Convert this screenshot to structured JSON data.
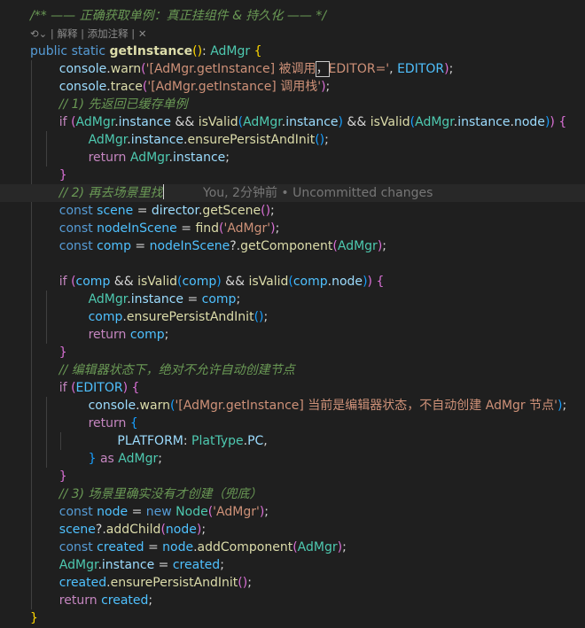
{
  "app": "code-editor",
  "code_lens": {
    "icon": "references-icon",
    "explain": "解释",
    "add_comment": "添加注释",
    "close_icon": "close-icon"
  },
  "blame": "You, 2分钟前 • Uncommitted changes",
  "colors": {
    "background": "#1f1f1f",
    "comment": "#6a9955",
    "keyword": "#569cd6",
    "control": "#c586c0",
    "function": "#dcdcaa",
    "type": "#4ec9b0",
    "string": "#ce9178",
    "variable": "#9cdcfe",
    "constant": "#4fc1ff",
    "bracket_1": "#ffd700",
    "bracket_2": "#da70d6",
    "bracket_3": "#179fff"
  },
  "lines": [
    {
      "indent": 2,
      "tokens": [
        [
          "cm",
          "/** —— 正确获取单例：真正挂组件 & 持久化 —— */"
        ]
      ]
    },
    {
      "lens": true
    },
    {
      "indent": 2,
      "tokens": [
        [
          "kw",
          "public"
        ],
        [
          "pn",
          " "
        ],
        [
          "kw",
          "static"
        ],
        [
          "pn",
          " "
        ],
        [
          "fb",
          "getInstance"
        ],
        [
          "b1",
          "()"
        ],
        [
          "pn",
          ": "
        ],
        [
          "ty",
          "AdMgr"
        ],
        [
          "pn",
          " "
        ],
        [
          "b1",
          "{"
        ]
      ]
    },
    {
      "indent": 6,
      "tokens": [
        [
          "vr",
          "console"
        ],
        [
          "pn",
          "."
        ],
        [
          "fn",
          "warn"
        ],
        [
          "b2",
          "("
        ],
        [
          "st",
          "'[AdMgr.getInstance] 被调用"
        ],
        [
          "sel",
          "，"
        ],
        [
          "st",
          "EDITOR='"
        ],
        [
          "pn",
          ", "
        ],
        [
          "co",
          "EDITOR"
        ],
        [
          "b2",
          ")"
        ],
        [
          "pn",
          ";"
        ]
      ]
    },
    {
      "indent": 6,
      "tokens": [
        [
          "vr",
          "console"
        ],
        [
          "pn",
          "."
        ],
        [
          "fn",
          "trace"
        ],
        [
          "b2",
          "("
        ],
        [
          "st",
          "'[AdMgr.getInstance] 调用栈'"
        ],
        [
          "b2",
          ")"
        ],
        [
          "pn",
          ";"
        ]
      ]
    },
    {
      "indent": 6,
      "tokens": [
        [
          "cm",
          "// 1) 先返回已缓存单例"
        ]
      ]
    },
    {
      "indent": 6,
      "tokens": [
        [
          "ct",
          "if"
        ],
        [
          "pn",
          " "
        ],
        [
          "b2",
          "("
        ],
        [
          "ty",
          "AdMgr"
        ],
        [
          "pn",
          "."
        ],
        [
          "vr",
          "instance"
        ],
        [
          "pn",
          " && "
        ],
        [
          "fn",
          "isValid"
        ],
        [
          "b3",
          "("
        ],
        [
          "ty",
          "AdMgr"
        ],
        [
          "pn",
          "."
        ],
        [
          "vr",
          "instance"
        ],
        [
          "b3",
          ")"
        ],
        [
          "pn",
          " && "
        ],
        [
          "fn",
          "isValid"
        ],
        [
          "b3",
          "("
        ],
        [
          "ty",
          "AdMgr"
        ],
        [
          "pn",
          "."
        ],
        [
          "vr",
          "instance"
        ],
        [
          "pn",
          "."
        ],
        [
          "vr",
          "node"
        ],
        [
          "b3",
          ")"
        ],
        [
          "b2",
          ")"
        ],
        [
          "pn",
          " "
        ],
        [
          "b2",
          "{"
        ]
      ]
    },
    {
      "indent": 10,
      "tokens": [
        [
          "ty",
          "AdMgr"
        ],
        [
          "pn",
          "."
        ],
        [
          "vr",
          "instance"
        ],
        [
          "pn",
          "."
        ],
        [
          "fn",
          "ensurePersistAndInit"
        ],
        [
          "b3",
          "()"
        ],
        [
          "pn",
          ";"
        ]
      ]
    },
    {
      "indent": 10,
      "tokens": [
        [
          "ct",
          "return"
        ],
        [
          "pn",
          " "
        ],
        [
          "ty",
          "AdMgr"
        ],
        [
          "pn",
          "."
        ],
        [
          "vr",
          "instance"
        ],
        [
          "pn",
          ";"
        ]
      ]
    },
    {
      "indent": 6,
      "tokens": [
        [
          "b2",
          "}"
        ]
      ]
    },
    {
      "indent": 6,
      "current": true,
      "blame": true,
      "tokens": [
        [
          "cm",
          "// 2) 再去场景里找"
        ],
        [
          "cursor",
          ""
        ]
      ]
    },
    {
      "indent": 6,
      "tokens": [
        [
          "kw",
          "const"
        ],
        [
          "pn",
          " "
        ],
        [
          "co",
          "scene"
        ],
        [
          "pn",
          " = "
        ],
        [
          "vr",
          "director"
        ],
        [
          "pn",
          "."
        ],
        [
          "fn",
          "getScene"
        ],
        [
          "b2",
          "()"
        ],
        [
          "pn",
          ";"
        ]
      ]
    },
    {
      "indent": 6,
      "tokens": [
        [
          "kw",
          "const"
        ],
        [
          "pn",
          " "
        ],
        [
          "co",
          "nodeInScene"
        ],
        [
          "pn",
          " = "
        ],
        [
          "fn",
          "find"
        ],
        [
          "b2",
          "("
        ],
        [
          "st",
          "'AdMgr'"
        ],
        [
          "b2",
          ")"
        ],
        [
          "pn",
          ";"
        ]
      ]
    },
    {
      "indent": 6,
      "tokens": [
        [
          "kw",
          "const"
        ],
        [
          "pn",
          " "
        ],
        [
          "co",
          "comp"
        ],
        [
          "pn",
          " = "
        ],
        [
          "co",
          "nodeInScene"
        ],
        [
          "pn",
          "?."
        ],
        [
          "fn",
          "getComponent"
        ],
        [
          "b2",
          "("
        ],
        [
          "ty",
          "AdMgr"
        ],
        [
          "b2",
          ")"
        ],
        [
          "pn",
          ";"
        ]
      ]
    },
    {
      "indent": 0,
      "tokens": []
    },
    {
      "indent": 6,
      "tokens": [
        [
          "ct",
          "if"
        ],
        [
          "pn",
          " "
        ],
        [
          "b2",
          "("
        ],
        [
          "co",
          "comp"
        ],
        [
          "pn",
          " && "
        ],
        [
          "fn",
          "isValid"
        ],
        [
          "b3",
          "("
        ],
        [
          "co",
          "comp"
        ],
        [
          "b3",
          ")"
        ],
        [
          "pn",
          " && "
        ],
        [
          "fn",
          "isValid"
        ],
        [
          "b3",
          "("
        ],
        [
          "co",
          "comp"
        ],
        [
          "pn",
          "."
        ],
        [
          "vr",
          "node"
        ],
        [
          "b3",
          ")"
        ],
        [
          "b2",
          ")"
        ],
        [
          "pn",
          " "
        ],
        [
          "b2",
          "{"
        ]
      ]
    },
    {
      "indent": 10,
      "tokens": [
        [
          "ty",
          "AdMgr"
        ],
        [
          "pn",
          "."
        ],
        [
          "vr",
          "instance"
        ],
        [
          "pn",
          " = "
        ],
        [
          "co",
          "comp"
        ],
        [
          "pn",
          ";"
        ]
      ]
    },
    {
      "indent": 10,
      "tokens": [
        [
          "co",
          "comp"
        ],
        [
          "pn",
          "."
        ],
        [
          "fn",
          "ensurePersistAndInit"
        ],
        [
          "b3",
          "()"
        ],
        [
          "pn",
          ";"
        ]
      ]
    },
    {
      "indent": 10,
      "tokens": [
        [
          "ct",
          "return"
        ],
        [
          "pn",
          " "
        ],
        [
          "co",
          "comp"
        ],
        [
          "pn",
          ";"
        ]
      ]
    },
    {
      "indent": 6,
      "tokens": [
        [
          "b2",
          "}"
        ]
      ]
    },
    {
      "indent": 6,
      "tokens": [
        [
          "cm",
          "// 编辑器状态下，绝对不允许自动创建节点"
        ]
      ]
    },
    {
      "indent": 6,
      "tokens": [
        [
          "ct",
          "if"
        ],
        [
          "pn",
          " "
        ],
        [
          "b2",
          "("
        ],
        [
          "co",
          "EDITOR"
        ],
        [
          "b2",
          ")"
        ],
        [
          "pn",
          " "
        ],
        [
          "b2",
          "{"
        ]
      ]
    },
    {
      "indent": 10,
      "tokens": [
        [
          "vr",
          "console"
        ],
        [
          "pn",
          "."
        ],
        [
          "fn",
          "warn"
        ],
        [
          "b3",
          "("
        ],
        [
          "st",
          "'[AdMgr.getInstance] 当前是编辑器状态，不自动创建 AdMgr 节点'"
        ],
        [
          "b3",
          ")"
        ],
        [
          "pn",
          ";"
        ]
      ]
    },
    {
      "indent": 10,
      "tokens": [
        [
          "ct",
          "return"
        ],
        [
          "pn",
          " "
        ],
        [
          "b3",
          "{"
        ]
      ]
    },
    {
      "indent": 14,
      "tokens": [
        [
          "vr",
          "PLATFORM"
        ],
        [
          "pn",
          ": "
        ],
        [
          "ty",
          "PlatType"
        ],
        [
          "pn",
          "."
        ],
        [
          "vr",
          "PC"
        ],
        [
          "pn",
          ","
        ]
      ]
    },
    {
      "indent": 10,
      "tokens": [
        [
          "b3",
          "}"
        ],
        [
          "pn",
          " "
        ],
        [
          "ct",
          "as"
        ],
        [
          "pn",
          " "
        ],
        [
          "ty",
          "AdMgr"
        ],
        [
          "pn",
          ";"
        ]
      ]
    },
    {
      "indent": 6,
      "tokens": [
        [
          "b2",
          "}"
        ]
      ]
    },
    {
      "indent": 6,
      "tokens": [
        [
          "cm",
          "// 3) 场景里确实没有才创建（兜底）"
        ]
      ]
    },
    {
      "indent": 6,
      "tokens": [
        [
          "kw",
          "const"
        ],
        [
          "pn",
          " "
        ],
        [
          "co",
          "node"
        ],
        [
          "pn",
          " = "
        ],
        [
          "kw",
          "new"
        ],
        [
          "pn",
          " "
        ],
        [
          "ty",
          "Node"
        ],
        [
          "b2",
          "("
        ],
        [
          "st",
          "'AdMgr'"
        ],
        [
          "b2",
          ")"
        ],
        [
          "pn",
          ";"
        ]
      ]
    },
    {
      "indent": 6,
      "tokens": [
        [
          "co",
          "scene"
        ],
        [
          "pn",
          "?."
        ],
        [
          "fn",
          "addChild"
        ],
        [
          "b2",
          "("
        ],
        [
          "co",
          "node"
        ],
        [
          "b2",
          ")"
        ],
        [
          "pn",
          ";"
        ]
      ]
    },
    {
      "indent": 6,
      "tokens": [
        [
          "kw",
          "const"
        ],
        [
          "pn",
          " "
        ],
        [
          "co",
          "created"
        ],
        [
          "pn",
          " = "
        ],
        [
          "co",
          "node"
        ],
        [
          "pn",
          "."
        ],
        [
          "fn",
          "addComponent"
        ],
        [
          "b2",
          "("
        ],
        [
          "ty",
          "AdMgr"
        ],
        [
          "b2",
          ")"
        ],
        [
          "pn",
          ";"
        ]
      ]
    },
    {
      "indent": 6,
      "tokens": [
        [
          "ty",
          "AdMgr"
        ],
        [
          "pn",
          "."
        ],
        [
          "vr",
          "instance"
        ],
        [
          "pn",
          " = "
        ],
        [
          "co",
          "created"
        ],
        [
          "pn",
          ";"
        ]
      ]
    },
    {
      "indent": 6,
      "tokens": [
        [
          "co",
          "created"
        ],
        [
          "pn",
          "."
        ],
        [
          "fn",
          "ensurePersistAndInit"
        ],
        [
          "b2",
          "()"
        ],
        [
          "pn",
          ";"
        ]
      ]
    },
    {
      "indent": 6,
      "tokens": [
        [
          "ct",
          "return"
        ],
        [
          "pn",
          " "
        ],
        [
          "co",
          "created"
        ],
        [
          "pn",
          ";"
        ]
      ]
    },
    {
      "indent": 2,
      "tokens": [
        [
          "b1",
          "}"
        ]
      ]
    }
  ]
}
